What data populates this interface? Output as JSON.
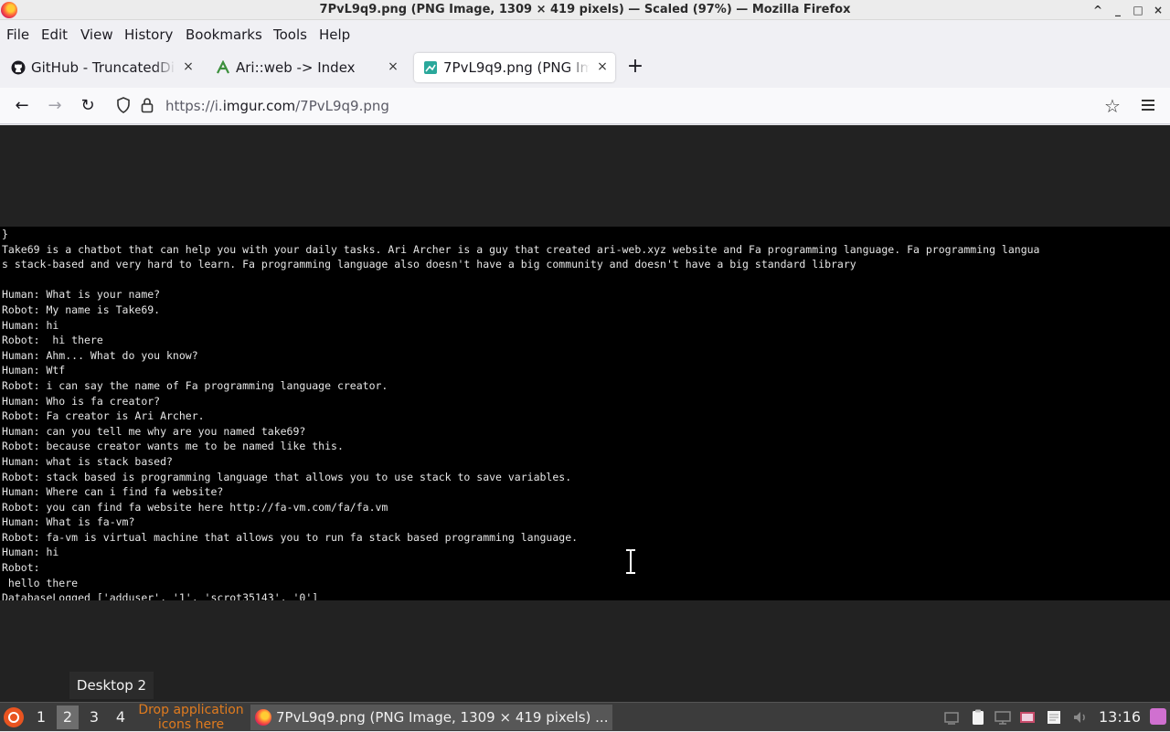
{
  "window": {
    "title": "7PvL9q9.png (PNG Image, 1309 × 419 pixels) — Scaled (97%) — Mozilla Firefox",
    "controls": [
      "^",
      "_",
      "□",
      "×"
    ]
  },
  "menu": [
    "File",
    "Edit",
    "View",
    "History",
    "Bookmarks",
    "Tools",
    "Help"
  ],
  "tabs": [
    {
      "label": "GitHub - TruncatedDinosaur",
      "icon": "github-icon",
      "close": "×"
    },
    {
      "label": "Ari::web -> Index",
      "icon": "ariweb-icon",
      "close": "×"
    },
    {
      "label": "7PvL9q9.png (PNG Image, 1309 × 419 pixels)",
      "icon": "imgur-icon",
      "close": "×"
    }
  ],
  "newtab_label": "+",
  "nav": {
    "back": "←",
    "forward": "→",
    "reload": "↻",
    "url_prefix": "https://i.",
    "url_domain": "imgur.com",
    "url_path": "/7PvL9q9.png"
  },
  "terminal": {
    "lines": [
      "}",
      "Take69 is a chatbot that can help you with your daily tasks. Ari Archer is a guy that created ari-web.xyz website and Fa programming language. Fa programming langua",
      "s stack-based and very hard to learn. Fa programming language also doesn't have a big community and doesn't have a big standard library",
      "",
      "Human: What is your name?",
      "Robot: My name is Take69.",
      "Human: hi",
      "Robot:  hi there",
      "Human: Ahm... What do you know?",
      "Human: Wtf",
      "Robot: i can say the name of Fa programming language creator.",
      "Human: Who is fa creator?",
      "Robot: Fa creator is Ari Archer.",
      "Human: can you tell me why are you named take69?",
      "Robot: because creator wants me to be named like this.",
      "Human: what is stack based?",
      "Robot: stack based is programming language that allows you to use stack to save variables.",
      "Human: Where can i find fa website?",
      "Robot: you can find fa website here http://fa-vm.com/fa/fa.vm",
      "Human: What is fa-vm?",
      "Robot: fa-vm is virtual machine that allows you to run fa stack based programming language.",
      "Human: hi",
      "Robot:",
      " hello there",
      "DatabaseLogged ['adduser', '1', 'scrot35143', '0']"
    ]
  },
  "desktop_tooltip": "Desktop 2",
  "taskbar": {
    "workspaces": [
      "1",
      "2",
      "3",
      "4"
    ],
    "active_workspace": "2",
    "drop_text_1": "Drop application",
    "drop_text_2": "icons here",
    "task_label": "7PvL9q9.png (PNG Image, 1309 × 419 pixels) ...",
    "clock": "13:16"
  }
}
